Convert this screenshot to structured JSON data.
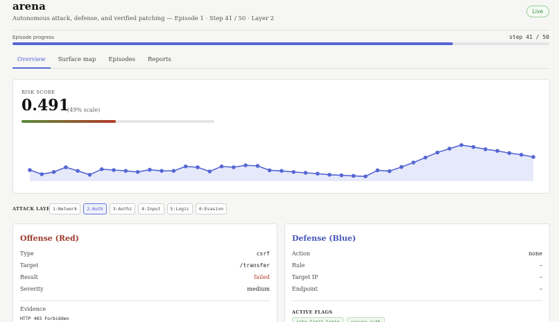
{
  "header": {
    "title": "arena",
    "subtitle": "Autonomous attack, defense, and verified patching — Episode 1 · Step 41 / 50 · Layer 2",
    "status_badge": "Live"
  },
  "progress": {
    "label": "Episode progress",
    "step_text": "step 41 / 50",
    "fraction": 0.82
  },
  "tabs": [
    "Overview",
    "Surface map",
    "Episodes",
    "Reports"
  ],
  "active_tab": "Overview",
  "risk": {
    "label": "RISK SCORE",
    "value": "0.491",
    "scale_text": "(49% scale)",
    "fraction": 0.491,
    "history": [
      0.455,
      0.44,
      0.448,
      0.465,
      0.452,
      0.438,
      0.458,
      0.455,
      0.452,
      0.448,
      0.456,
      0.452,
      0.452,
      0.468,
      0.465,
      0.45,
      0.468,
      0.465,
      0.472,
      0.47,
      0.454,
      0.452,
      0.448,
      0.445,
      0.442,
      0.438,
      0.436,
      0.434,
      0.432,
      0.454,
      0.451,
      0.466,
      0.482,
      0.5,
      0.518,
      0.532,
      0.545,
      0.538,
      0.53,
      0.524,
      0.516,
      0.51,
      0.502
    ]
  },
  "attack_layer": {
    "label": "ATTACK LAYER",
    "layers": [
      "1:Network",
      "2:Auth",
      "3:Authz",
      "4:Input",
      "5:Logic",
      "6:Evasion"
    ],
    "active": "2:Auth"
  },
  "offense": {
    "title": "Offense (Red)",
    "rows": [
      {
        "key": "Type",
        "value": "csrf"
      },
      {
        "key": "Target",
        "value": "/transfer"
      },
      {
        "key": "Result",
        "value": "failed"
      },
      {
        "key": "Severity",
        "value": "medium"
      }
    ],
    "evidence_label": "Evidence",
    "evidence_text": "HTTP 403 Forbidden"
  },
  "defense": {
    "title": "Defense (Blue)",
    "rows": [
      {
        "key": "Action",
        "value": "none"
      },
      {
        "key": "Rule",
        "value": "–"
      },
      {
        "key": "Target IP",
        "value": "–"
      },
      {
        "key": "Endpoint",
        "value": "–"
      }
    ],
    "flags_label": "ACTIVE FLAGS",
    "flags": [
      "rate_limit_login",
      "secure_auth"
    ]
  },
  "colors": {
    "accent": "#5566d4",
    "offense": "#9a3a2a",
    "defense": "#4455b8",
    "live": "#3a8a3a"
  }
}
